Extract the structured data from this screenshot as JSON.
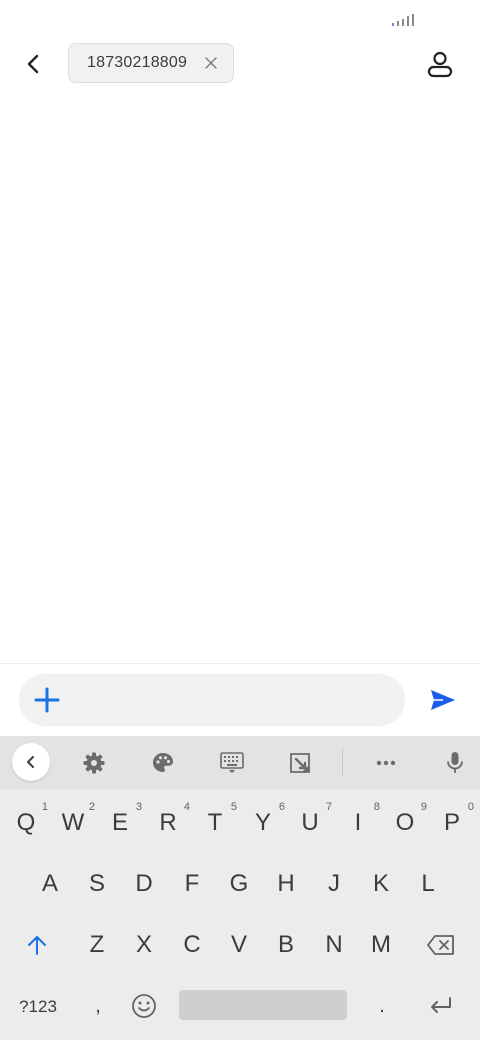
{
  "status_bar": {
    "signal_icon": "signal-bars-icon"
  },
  "header": {
    "back_icon": "back-arrow-icon",
    "recipient": "18730218809",
    "remove_icon": "close-icon",
    "contact_icon": "contact-icon"
  },
  "compose": {
    "attach_icon": "plus-icon",
    "message_value": "",
    "send_icon": "send-icon",
    "accent_color": "#1a73e8"
  },
  "keyboard": {
    "toolbar": {
      "collapse_icon": "chevron-left-icon",
      "settings_icon": "gear-icon",
      "theme_icon": "palette-icon",
      "layout_icon": "keyboard-icon",
      "clipboard_icon": "edit-icon",
      "more_icon": "more-icon",
      "voice_icon": "microphone-icon"
    },
    "row1": [
      {
        "key": "Q",
        "hint": "1"
      },
      {
        "key": "W",
        "hint": "2"
      },
      {
        "key": "E",
        "hint": "3"
      },
      {
        "key": "R",
        "hint": "4"
      },
      {
        "key": "T",
        "hint": "5"
      },
      {
        "key": "Y",
        "hint": "6"
      },
      {
        "key": "U",
        "hint": "7"
      },
      {
        "key": "I",
        "hint": "8"
      },
      {
        "key": "O",
        "hint": "9"
      },
      {
        "key": "P",
        "hint": "0"
      }
    ],
    "row2": [
      "A",
      "S",
      "D",
      "F",
      "G",
      "H",
      "J",
      "K",
      "L"
    ],
    "row3": [
      "Z",
      "X",
      "C",
      "V",
      "B",
      "N",
      "M"
    ],
    "shift_icon": "shift-arrow-icon",
    "backspace_icon": "backspace-icon",
    "symbols_label": "?123",
    "comma_label": ",",
    "emoji_icon": "emoji-icon",
    "period_label": ".",
    "enter_icon": "enter-icon",
    "shift_color": "#1a73e8"
  }
}
